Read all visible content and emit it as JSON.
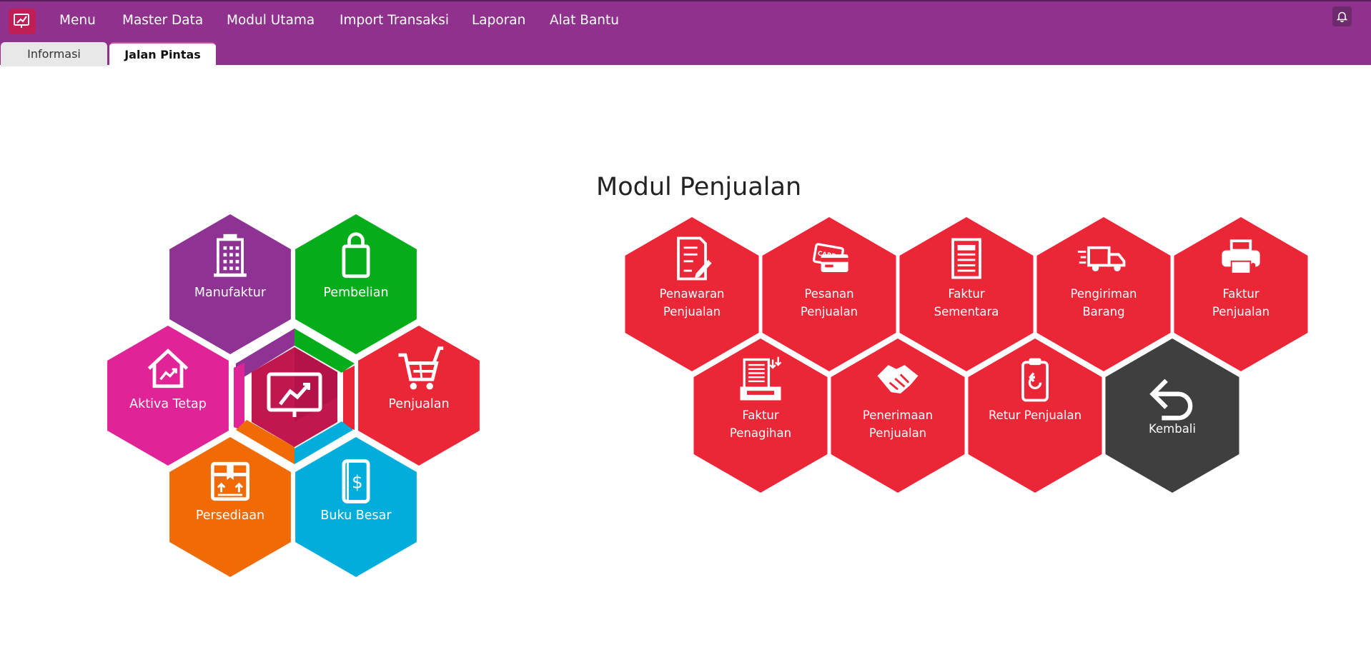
{
  "app": {
    "logo_icon": "app-logo-chart-icon"
  },
  "menu": {
    "items": [
      "Menu",
      "Master Data",
      "Modul Utama",
      "Import Transaksi",
      "Laporan",
      "Alat Bantu"
    ]
  },
  "tabs": [
    {
      "label": "Informasi",
      "active": false
    },
    {
      "label": "Jalan Pintas",
      "active": true
    }
  ],
  "notification": {
    "icon": "bell-icon"
  },
  "section_title": "Modul Penjualan",
  "colors": {
    "topbar": "#90318e",
    "manufaktur": "#8e3294",
    "pembelian": "#06ad1b",
    "penjualan": "#eb2637",
    "aktiva": "#e02497",
    "persediaan": "#f06b05",
    "buku_besar": "#01aedb",
    "center": "#c0174e",
    "module_tile": "#eb2637",
    "back_tile": "#3f3f3f"
  },
  "main_modules": [
    {
      "label": "Manufaktur",
      "icon": "building-icon"
    },
    {
      "label": "Pembelian",
      "icon": "shopping-bag-icon"
    },
    {
      "label": "Aktiva Tetap",
      "icon": "house-chart-icon"
    },
    {
      "label": "Penjualan",
      "icon": "shopping-cart-icon"
    },
    {
      "label": "Persediaan",
      "icon": "box-icon"
    },
    {
      "label": "Buku Besar",
      "icon": "ledger-book-icon"
    }
  ],
  "center_icon": "monitor-chart-icon",
  "sales_modules": [
    {
      "label": "Penawaran\nPenjualan",
      "icon": "document-pen-icon"
    },
    {
      "label": "Pesanan\nPenjualan",
      "icon": "credit-card-icon"
    },
    {
      "label": "Faktur\nSementara",
      "icon": "invoice-icon"
    },
    {
      "label": "Pengiriman\nBarang",
      "icon": "delivery-truck-icon"
    },
    {
      "label": "Faktur\nPenjualan",
      "icon": "printer-icon"
    },
    {
      "label": "Faktur\nPenagihan",
      "icon": "document-tray-icon"
    },
    {
      "label": "Penerimaan\nPenjualan",
      "icon": "handshake-icon"
    },
    {
      "label": "Retur Penjualan",
      "icon": "clipboard-return-icon"
    },
    {
      "label": "Kembali",
      "icon": "back-arrow-icon"
    }
  ]
}
